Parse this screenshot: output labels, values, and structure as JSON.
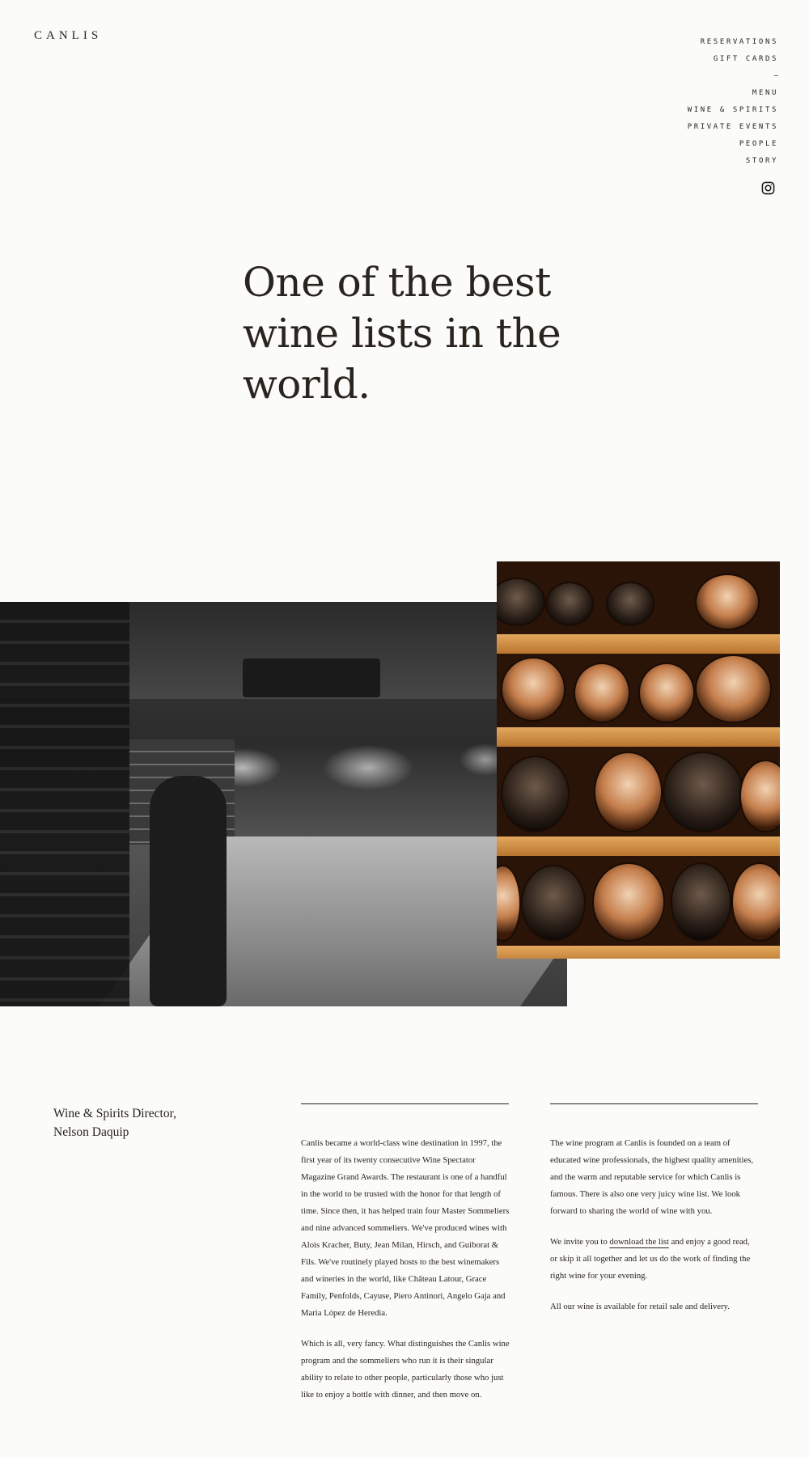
{
  "brand": {
    "logo": "CANLIS"
  },
  "nav": {
    "reservations": "RESERVATIONS",
    "gift_cards": "GIFT CARDS",
    "separator": "—",
    "menu": "MENU",
    "wine_spirits": "WINE & SPIRITS",
    "private_events": "PRIVATE EVENTS",
    "people": "PEOPLE",
    "story": "STORY",
    "instagram_icon": "instagram-icon"
  },
  "hero": {
    "title": "One of the best wine lists in the world."
  },
  "images": {
    "cellar_photo": "wine-cellar-photo",
    "racks_photo": "wine-racks-photo"
  },
  "director": {
    "line1": "Wine & Spirits Director,",
    "line2": "Nelson Daquip"
  },
  "column_left": {
    "p1": "Canlis became a world-class wine destination in 1997, the first year of its twenty consecutive Wine Spectator Magazine Grand Awards. The restaurant is one of a handful in the world to be trusted with the honor for that length of time. Since then, it has helped train four Master Sommeliers and nine advanced sommeliers. We've produced wines with Alois Kracher, Buty, Jean Milan, Hirsch, and Guiborat & Fils. We've routinely played hosts to the best winemakers and wineries in the world, like Château Latour, Grace Family, Penfolds, Cayuse, Piero Antinori, Angelo Gaja and Maria López de Heredia.",
    "p2": "Which is all, very fancy. What distinguishes the Canlis wine program and the sommeliers who run it is their singular ability to relate to other people, particularly those who just like to enjoy a bottle with dinner, and then move on."
  },
  "column_right": {
    "p1": "The wine program at Canlis is founded on a team of educated wine professionals, the highest quality amenities, and the warm and reputable service for which Canlis is famous. There is also one very juicy wine list. We look forward to sharing the world of wine with you.",
    "p2_before": "We invite you to ",
    "p2_link": "download the list",
    "p2_after": " and enjoy a good read, or skip it all together and let us do the work of finding the right wine for your evening.",
    "p3": "All our wine is available for retail sale and delivery."
  }
}
